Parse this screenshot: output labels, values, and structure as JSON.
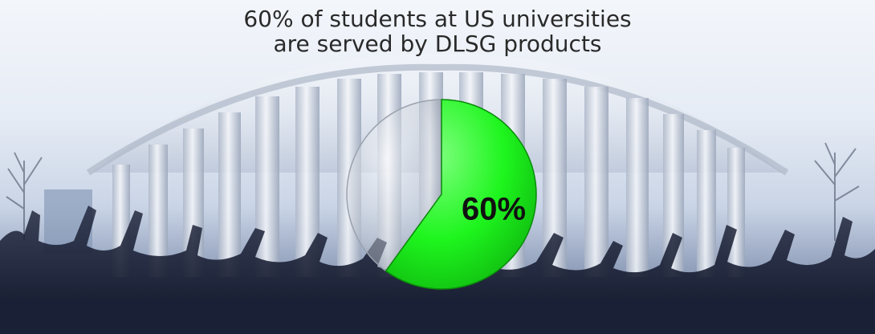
{
  "header": {
    "title_line1": "60% of students at US universities",
    "title_line2": "are served by DLSG products"
  },
  "chart_data": {
    "type": "pie",
    "title": "60% of students at US universities are served by DLSG products",
    "slices": [
      {
        "label": "60%",
        "value": 60,
        "color": "#1ef51e"
      },
      {
        "label": "",
        "value": 40,
        "color": "#cfd3d8"
      }
    ],
    "data_label": "60%"
  },
  "colors": {
    "highlight": "#1ef51e",
    "remainder": "#cfd3d8",
    "title_text": "#2a2a2a"
  }
}
